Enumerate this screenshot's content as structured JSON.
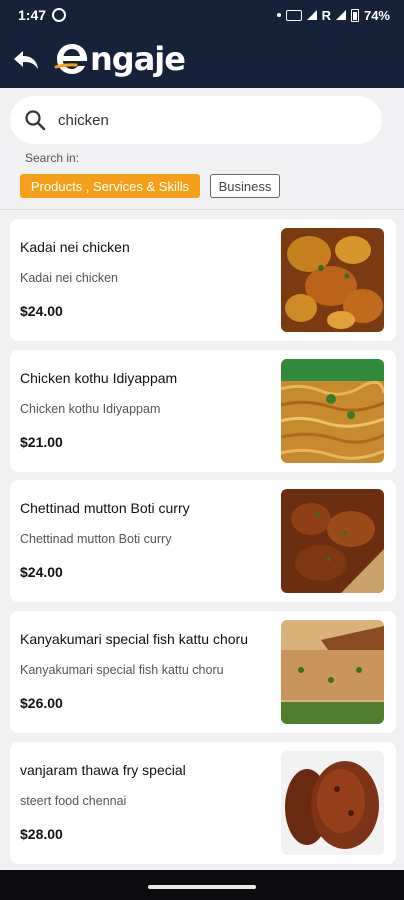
{
  "status_bar": {
    "time": "1:47",
    "network": "R",
    "battery": "74%"
  },
  "header": {
    "brand": "ngaje"
  },
  "search": {
    "value": "chicken",
    "placeholder": "Search"
  },
  "filters": {
    "label": "Search in:",
    "chips": [
      {
        "label": "Products , Services & Skills",
        "selected": true
      },
      {
        "label": "Business",
        "selected": false
      }
    ],
    "accent_color": "#f6a01a"
  },
  "results": [
    {
      "name": "Kadai nei chicken",
      "description": "Kadai nei chicken",
      "price": "$24.00",
      "image": "chicken-curry-photo"
    },
    {
      "name": "Chicken kothu Idiyappam",
      "description": "Chicken kothu Idiyappam",
      "price": "$21.00",
      "image": "idiyappam-photo"
    },
    {
      "name": "Chettinad mutton Boti curry",
      "description": "Chettinad mutton Boti curry",
      "price": "$24.00",
      "image": "mutton-curry-photo"
    },
    {
      "name": "Kanyakumari special fish kattu choru",
      "description": "Kanyakumari special fish kattu choru",
      "price": "$26.00",
      "image": "fish-rice-photo"
    },
    {
      "name": "vanjaram thawa fry special",
      "description": "steert food chennai",
      "price": "$28.00",
      "image": "fish-fry-photo"
    }
  ]
}
